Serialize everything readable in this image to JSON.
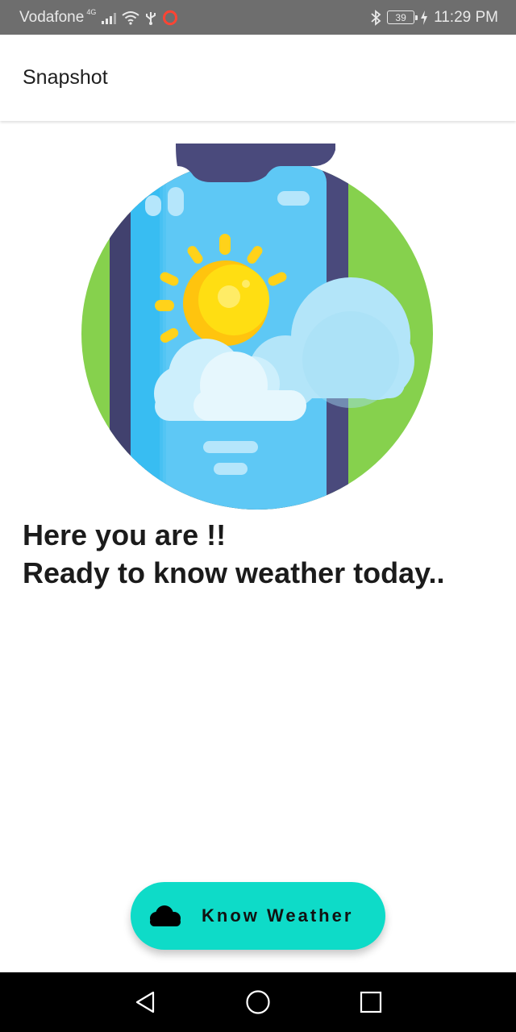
{
  "status_bar": {
    "carrier": "Vodafone",
    "network_type": "4G",
    "battery_level": "39",
    "time": "11:29 PM",
    "icons": [
      "signal-icon",
      "wifi-icon",
      "usb-icon",
      "opera-icon",
      "bluetooth-icon",
      "battery-icon",
      "charging-icon"
    ]
  },
  "app_bar": {
    "title": "Snapshot"
  },
  "illustration": {
    "icon": "weather-phone-illustration"
  },
  "main": {
    "headline_line1": "Here you are !!",
    "headline_line2": "Ready to know weather today.."
  },
  "action_button": {
    "label": "Know Weather",
    "icon": "cloud-icon",
    "color": "#0edbc8"
  },
  "nav_bar": {
    "icons": [
      "back-icon",
      "home-icon",
      "recents-icon"
    ]
  },
  "colors": {
    "status_bar_bg": "#6e6e6e",
    "accent": "#0edbc8",
    "circle_green": "#86d14d",
    "phone_frame": "#4a4a7c",
    "screen_blue": "#5ec8f5"
  }
}
